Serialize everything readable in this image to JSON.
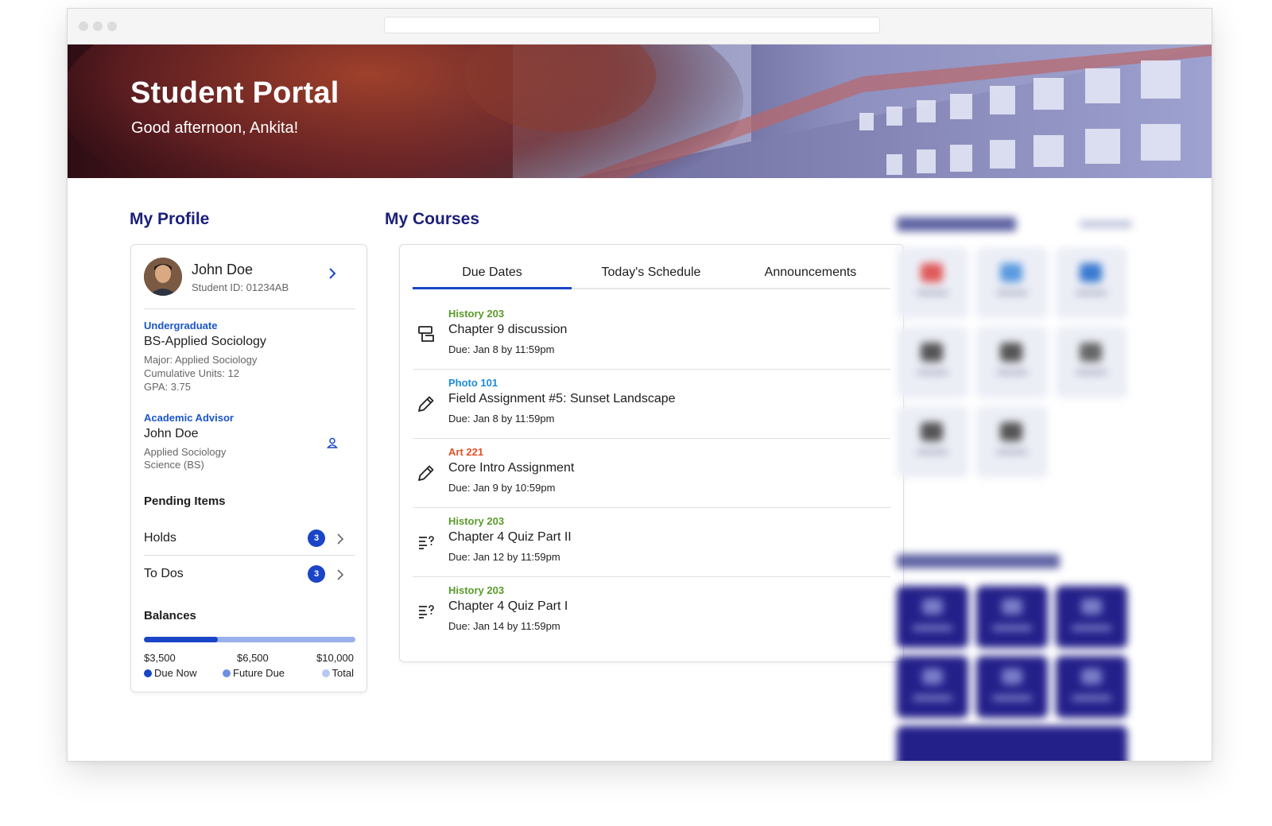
{
  "hero": {
    "title": "Student Portal",
    "greeting": "Good afternoon, Ankita!"
  },
  "profile": {
    "section_title": "My Profile",
    "name": "John Doe",
    "student_id": "Student ID: 01234AB",
    "program_level": "Undergraduate",
    "program": "BS-Applied Sociology",
    "major": "Major: Applied Sociology",
    "units": "Cumulative Units: 12",
    "gpa": "GPA: 3.75",
    "advisor_label": "Academic Advisor",
    "advisor_name": "John Doe",
    "advisor_dept_line1": "Applied Sociology",
    "advisor_dept_line2": "Science (BS)",
    "pending_label": "Pending Items",
    "holds_label": "Holds",
    "holds_count": "3",
    "todos_label": "To Dos",
    "todos_count": "3",
    "balances_label": "Balances",
    "balance_due_now": "$3,500",
    "balance_future": "$6,500",
    "balance_total": "$10,000",
    "legend_due_now": "Due Now",
    "legend_future": "Future Due",
    "legend_total": "Total",
    "balance_fraction_due_now": 0.35
  },
  "courses": {
    "section_title": "My Courses",
    "tabs": [
      "Due Dates",
      "Today's Schedule",
      "Announcements"
    ],
    "active_tab": "Due Dates",
    "items": [
      {
        "tag": "History 203",
        "tag_color": "#5a9a2a",
        "icon": "discussion-icon",
        "title": "Chapter 9 discussion",
        "due": "Due: Jan 8 by 11:59pm"
      },
      {
        "tag": "Photo 101",
        "tag_color": "#1e8ad6",
        "icon": "pencil-icon",
        "title": "Field Assignment #5: Sunset Landscape",
        "due": "Due: Jan 8 by 11:59pm"
      },
      {
        "tag": "Art 221",
        "tag_color": "#e0522a",
        "icon": "pencil-icon",
        "title": "Core Intro Assignment",
        "due": "Due: Jan 9 by 10:59pm"
      },
      {
        "tag": "History 203",
        "tag_color": "#5a9a2a",
        "icon": "quiz-icon",
        "title": "Chapter 4 Quiz Part II",
        "due": "Due: Jan 12 by 11:59pm"
      },
      {
        "tag": "History 203",
        "tag_color": "#5a9a2a",
        "icon": "quiz-icon",
        "title": "Chapter 4 Quiz Part I",
        "due": "Due: Jan 14 by 11:59pm"
      }
    ]
  },
  "colors": {
    "accent": "#1a45c6",
    "heading": "#1b1f7a",
    "resource_tile": "#24208a",
    "due_now": "#1a45c6",
    "future_due": "#6e8fe0",
    "total": "#b9c8f2"
  }
}
